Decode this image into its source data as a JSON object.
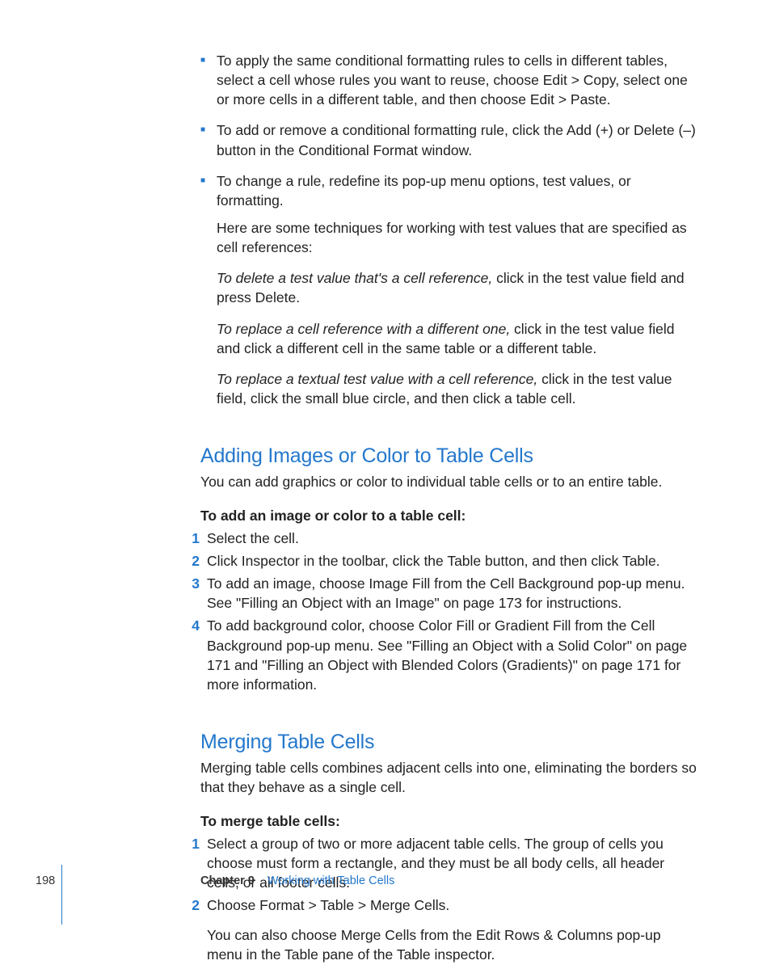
{
  "bullets": [
    {
      "text": "To apply the same conditional formatting rules to cells in different tables, select a cell whose rules you want to reuse, choose Edit > Copy, select one or more cells in a different table, and then choose Edit > Paste."
    },
    {
      "text": "To add or remove a conditional formatting rule, click the Add (+) or Delete (–) button in the Conditional Format window."
    },
    {
      "text": "To change a rule, redefine its pop-up menu options, test values, or formatting."
    }
  ],
  "sub_intro": "Here are some techniques for working with test values that are specified as cell references:",
  "sub_items": [
    {
      "italic": "To delete a test value that's a cell reference, ",
      "rest": "click in the test value field and press Delete."
    },
    {
      "italic": "To replace a cell reference with a different one, ",
      "rest": "click in the test value field and click a different cell in the same table or a different table."
    },
    {
      "italic": "To replace a textual test value with a cell reference, ",
      "rest": "click in the test value field, click the small blue circle, and then click a table cell."
    }
  ],
  "section1": {
    "heading": "Adding Images or Color to Table Cells",
    "intro": "You can add graphics or color to individual table cells or to an entire table.",
    "subhead": "To add an image or color to a table cell:",
    "steps": [
      "Select the cell.",
      "Click Inspector in the toolbar, click the Table button, and then click Table.",
      "To add an image, choose Image Fill from the Cell Background pop-up menu. See \"Filling an Object with an Image\" on page 173 for instructions.",
      "To add background color, choose Color Fill or Gradient Fill from the Cell Background pop-up menu. See \"Filling an Object with a Solid Color\" on page 171 and \"Filling an Object with Blended Colors (Gradients)\" on page 171 for more information."
    ]
  },
  "section2": {
    "heading": "Merging Table Cells",
    "intro": "Merging table cells combines adjacent cells into one, eliminating the borders so that they behave as a single cell.",
    "subhead": "To merge table cells:",
    "steps": [
      "Select a group of two or more adjacent table cells. The group of cells you choose must form a rectangle, and they must be all body cells, all header cells, or all footer cells.",
      "Choose Format > Table > Merge Cells."
    ],
    "after": "You can also choose Merge Cells from the Edit Rows & Columns pop-up menu in the Table pane of the Table inspector."
  },
  "footer": {
    "page": "198",
    "chapter": "Chapter 9",
    "title": "Working with Table Cells"
  },
  "nums": {
    "n1": "1",
    "n2": "2",
    "n3": "3",
    "n4": "4"
  }
}
